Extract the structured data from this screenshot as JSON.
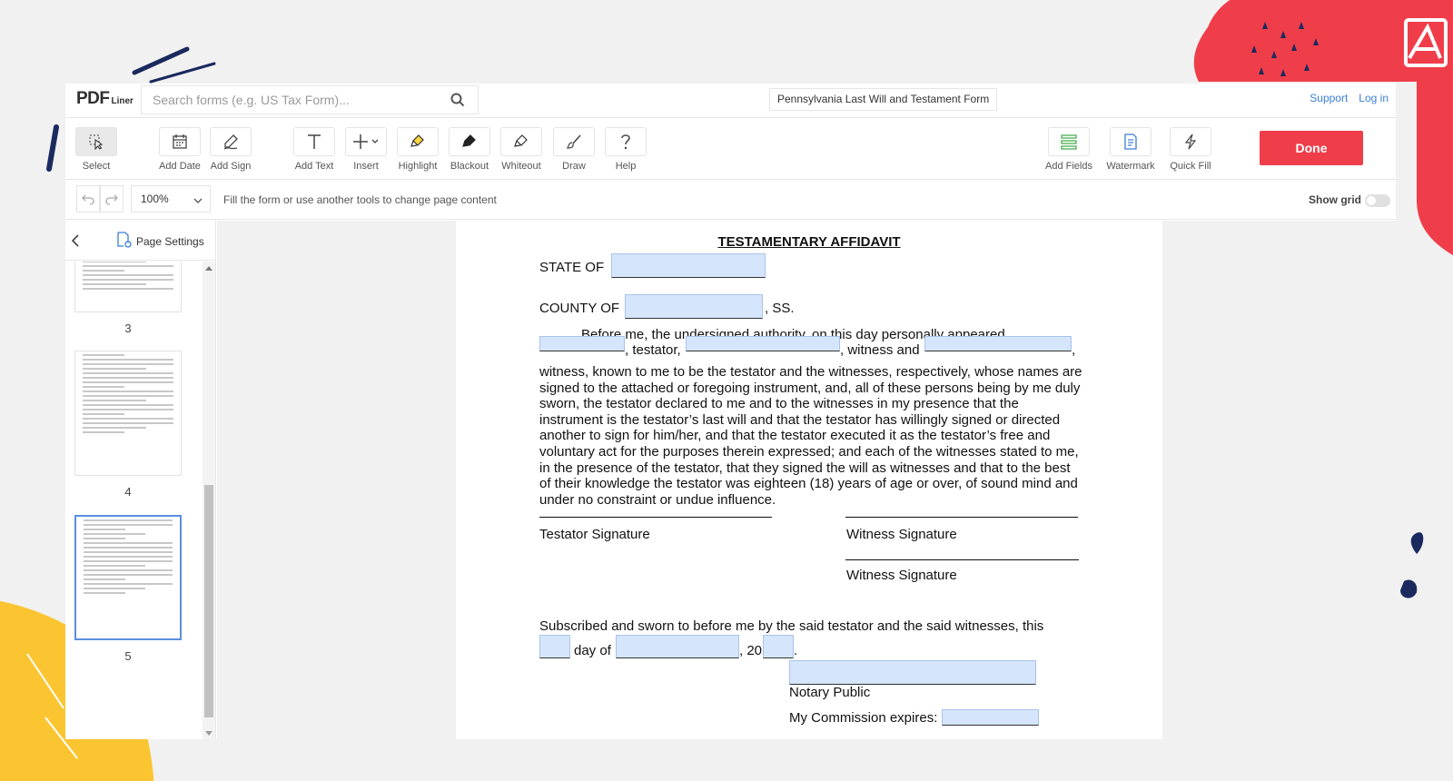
{
  "app": {
    "logo_pdf": "PDF",
    "logo_liner": "Liner",
    "search_placeholder": "Search forms (e.g. US Tax Form)...",
    "document_title": "Pennsylvania Last Will and Testament Form",
    "support_link": "Support",
    "login_link": "Log in"
  },
  "toolbar": {
    "select": "Select",
    "add_date": "Add Date",
    "add_sign": "Add Sign",
    "add_text": "Add Text",
    "insert": "Insert",
    "highlight": "Highlight",
    "blackout": "Blackout",
    "whiteout": "Whiteout",
    "draw": "Draw",
    "help": "Help",
    "add_fields": "Add Fields",
    "watermark": "Watermark",
    "quick_fill": "Quick Fill",
    "done": "Done"
  },
  "subbar": {
    "zoom": "100%",
    "hint": "Fill the form or use another tools to change page content",
    "show_grid": "Show grid",
    "show_grid_on": false
  },
  "sidebar": {
    "page_settings": "Page Settings",
    "pages": [
      "3",
      "4",
      "5"
    ],
    "active_page": "5"
  },
  "document": {
    "heading": "TESTAMENTARY AFFIDAVIT",
    "state_of": "STATE OF",
    "county_of": "COUNTY OF",
    "ss": ", SS.",
    "line1": "Before me, the undersigned authority, on this day personally appeared",
    "testator_sep": ", testator,",
    "witness_and": ", witness and",
    "comma": ",",
    "body": "witness, known to me to be the testator and the witnesses, respectively, whose names are signed to the attached or foregoing instrument, and, all of these persons being by me duly sworn, the testator declared to me and to the witnesses in my presence that the instrument is the testator’s last will and that the testator  has willingly signed or directed another to sign for him/her, and that the testator executed it as the testator’s free and voluntary act for the purposes therein expressed; and each of the witnesses stated to me, in the presence of the testator, that they signed the will as witnesses and that to the best of their knowledge the testator was eighteen (18) years of age or over, of sound mind and under no constraint or undue influence.",
    "testator_signature": "Testator Signature",
    "witness_signature_1": "Witness Signature",
    "witness_signature_2": "Witness Signature",
    "subscribed": "Subscribed and sworn to before me by the said testator and the said witnesses, this",
    "day_of": "day of",
    "year_prefix": ", 20",
    "period": ".",
    "notary_public": "Notary Public",
    "commission_expires": "My Commission expires:"
  },
  "colors": {
    "brand_red": "#ef3e4a",
    "link_blue": "#3a7fd5",
    "field_fill": "#d5e5fb",
    "deco_yellow": "#fbc531",
    "deco_navy": "#1a2a5e"
  }
}
